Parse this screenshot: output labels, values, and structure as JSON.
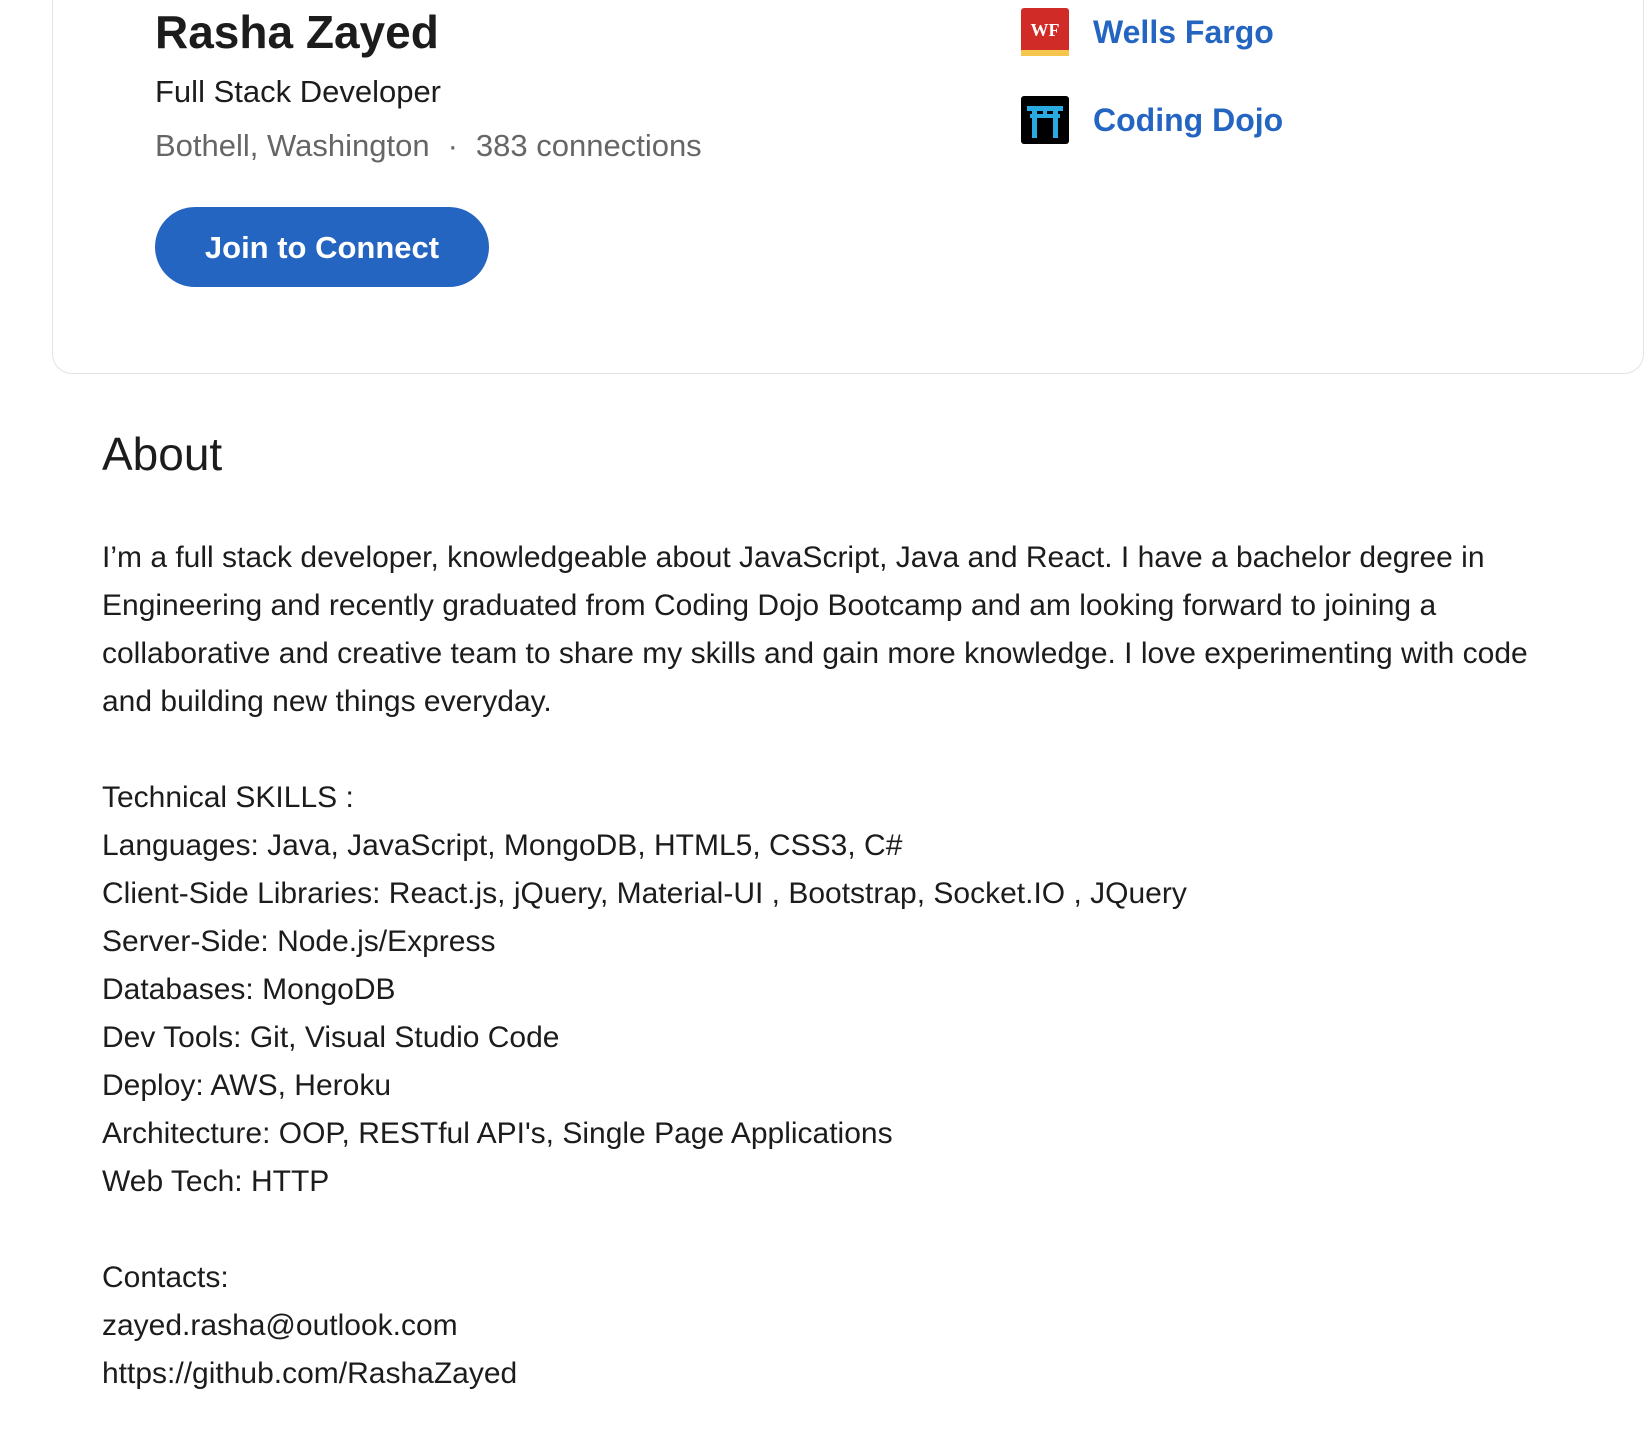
{
  "profile": {
    "name": "Rasha Zayed",
    "headline": "Full Stack Developer",
    "location": "Bothell, Washington",
    "separator": "·",
    "connections": "383 connections",
    "join_button": "Join to Connect"
  },
  "companies": [
    {
      "name": "Wells Fargo",
      "logo_text": "WF",
      "icon": "wells-fargo-logo"
    },
    {
      "name": "Coding Dojo",
      "icon": "coding-dojo-logo"
    }
  ],
  "about": {
    "title": "About",
    "body": "I’m a full stack developer, knowledgeable about JavaScript, Java and React. I have a bachelor degree in Engineering and recently graduated from Coding Dojo Bootcamp and am looking forward to joining a collaborative and creative team to share my skills and gain more knowledge. I love experimenting with code and building new things everyday.\n\nTechnical SKILLS :\nLanguages: Java, JavaScript, MongoDB, HTML5, CSS3, C#\nClient-Side Libraries: React.js, jQuery, Material-UI , Bootstrap, Socket.IO , JQuery\nServer-Side: Node.js/Express\nDatabases: MongoDB\nDev Tools: Git, Visual Studio Code\nDeploy: AWS, Heroku\nArchitecture: OOP, RESTful API's, Single Page Applications\nWeb Tech: HTTP\n\nContacts:\nzayed.rasha@outlook.com\nhttps://github.com/RashaZayed"
  },
  "colors": {
    "accent": "#2565c2",
    "wells_fargo_red": "#d12b27",
    "wells_fargo_yellow": "#f5c64b",
    "coding_dojo_blue": "#29abe2"
  }
}
